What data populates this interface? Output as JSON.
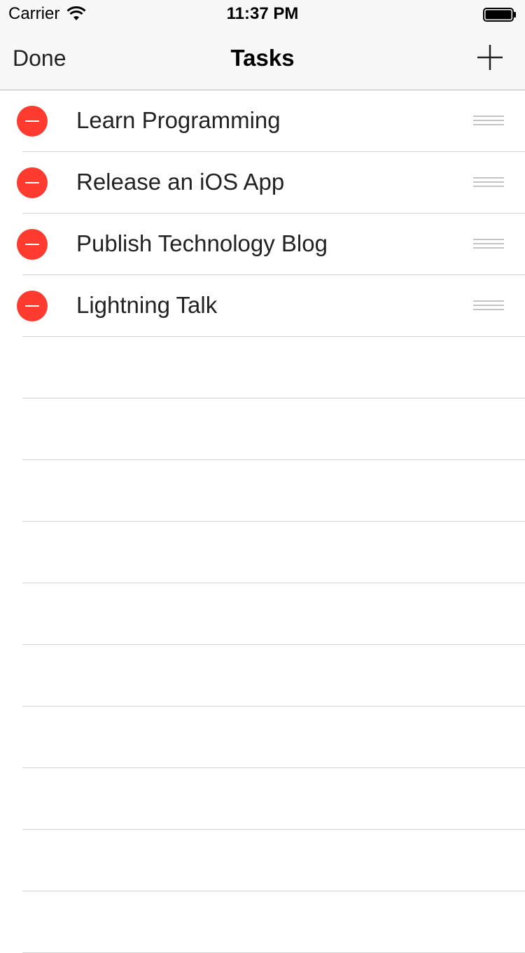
{
  "status_bar": {
    "carrier": "Carrier",
    "time": "11:37 PM"
  },
  "nav": {
    "left_button": "Done",
    "title": "Tasks",
    "right_icon": "plus-icon"
  },
  "tasks": [
    {
      "label": "Learn Programming"
    },
    {
      "label": "Release an iOS App"
    },
    {
      "label": "Publish Technology Blog"
    },
    {
      "label": "Lightning Talk"
    }
  ],
  "colors": {
    "delete": "#ff3b30",
    "nav_background": "#f7f7f7",
    "separator": "#d2d2d2",
    "reorder_handle": "#c4c4c4"
  }
}
